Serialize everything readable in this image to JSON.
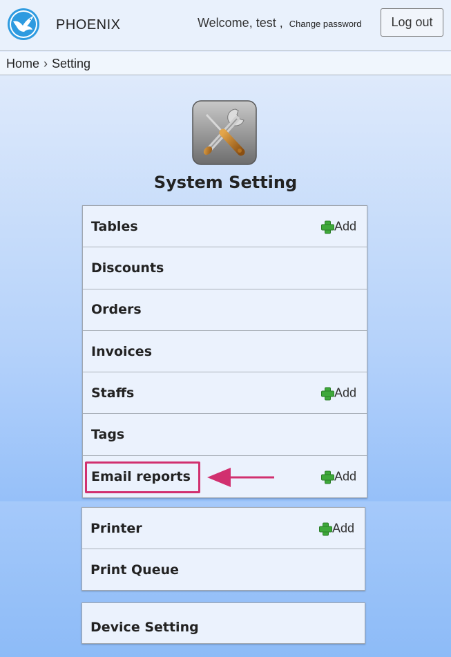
{
  "header": {
    "brand": "PHOENIX",
    "welcome_text": "Welcome, test ,",
    "change_password": "Change password",
    "logout_label": "Log out"
  },
  "breadcrumb": {
    "home": "Home",
    "separator": "›",
    "current": "Setting"
  },
  "page": {
    "title": "System Setting",
    "icon": "tools-icon"
  },
  "colors": {
    "accent_highlight": "#d1306f",
    "add_icon_green": "#3ea83a",
    "logo_blue": "#2e9be0"
  },
  "groups": [
    {
      "items": [
        {
          "label": "Tables",
          "add": "Add"
        },
        {
          "label": "Discounts"
        },
        {
          "label": "Orders"
        },
        {
          "label": "Invoices"
        },
        {
          "label": "Staffs",
          "add": "Add"
        },
        {
          "label": "Tags"
        },
        {
          "label": "Email reports",
          "add": "Add"
        }
      ]
    },
    {
      "items": [
        {
          "label": "Printer",
          "add": "Add"
        },
        {
          "label": "Print Queue"
        }
      ]
    },
    {
      "items": [
        {
          "label": "Device Setting"
        }
      ]
    }
  ]
}
